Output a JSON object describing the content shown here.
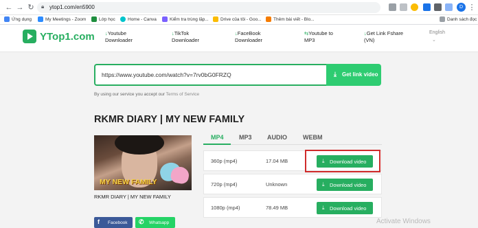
{
  "browser": {
    "url": "ytop1.com/en5900",
    "profile_initial": "D",
    "bookmarks": [
      {
        "label": "Ứng dụng",
        "color": "#4285f4"
      },
      {
        "label": "My Meetings - Zoom",
        "color": "#2d8cff"
      },
      {
        "label": "Lớp học",
        "color": "#1e8e3e"
      },
      {
        "label": "Home - Canva",
        "color": "#00c4cc"
      },
      {
        "label": "Kiểm tra trùng lặp...",
        "color": "#7b61ff"
      },
      {
        "label": "Drive của tôi - Goo...",
        "color": "#fbbc04"
      },
      {
        "label": "Thêm bài viết - Blo...",
        "color": "#f57c00"
      }
    ],
    "reading_list": "Danh sách đọc"
  },
  "site": {
    "logo": "YTop1.com",
    "nav": [
      {
        "icon": "↓",
        "line1": "Youtube",
        "line2": "Downloader"
      },
      {
        "icon": "↓",
        "line1": "TikTok",
        "line2": "Downloader"
      },
      {
        "icon": "↓",
        "line1": "FaceBook",
        "line2": "Downloader"
      },
      {
        "icon": "⇆",
        "line1": "Youtube to",
        "line2": "MP3"
      },
      {
        "icon": "↓",
        "line1": "Get Link Fshare",
        "line2": "(VN)"
      }
    ],
    "language": "English"
  },
  "search": {
    "value": "https://www.youtube.com/watch?v=7rv0bG0FRZQ",
    "button": "Get link video",
    "terms_prefix": "By using our service you accept our ",
    "terms_link": "Terms of Service"
  },
  "video": {
    "title": "RKMR DIARY | MY NEW FAMILY",
    "thumbnail_caption": "MY NEW FAMILY",
    "thumb_title": "RKMR DIARY | MY NEW FAMILY"
  },
  "tabs": [
    "MP4",
    "MP3",
    "AUDIO",
    "WEBM"
  ],
  "active_tab": "MP4",
  "downloads": [
    {
      "quality": "360p (mp4)",
      "size": "17.04 MB",
      "button": "Download video"
    },
    {
      "quality": "720p (mp4)",
      "size": "Unknown",
      "button": "Download video"
    },
    {
      "quality": "1080p (mp4)",
      "size": "78.49 MB",
      "button": "Download video"
    }
  ],
  "share": [
    {
      "label": "Facebook",
      "color": "#3b5998"
    },
    {
      "label": "Whatsapp",
      "color": "#25d366"
    }
  ],
  "watermark": "Activate Windows",
  "colors": {
    "brand": "#27ae60",
    "button": "#2ecc71",
    "highlight": "#d02a2a"
  }
}
